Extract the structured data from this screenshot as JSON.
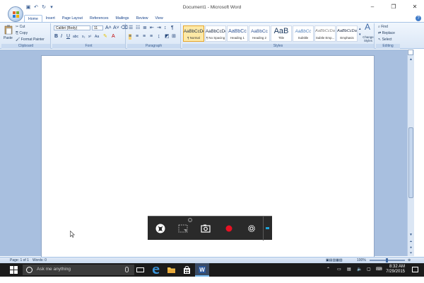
{
  "window": {
    "title": "Document1 - Microsoft Word",
    "controls": {
      "minimize": "‒",
      "maximize": "❐",
      "close": "✕"
    }
  },
  "tabs": [
    "Home",
    "Insert",
    "Page Layout",
    "References",
    "Mailings",
    "Review",
    "View"
  ],
  "active_tab": "Home",
  "ribbon": {
    "clipboard": {
      "label": "Clipboard",
      "paste": "Paste",
      "cut": "Cut",
      "copy": "Copy",
      "format_painter": "Format Painter"
    },
    "font": {
      "label": "Font",
      "font_name": "Calibri (Body)",
      "font_size": "11"
    },
    "paragraph": {
      "label": "Paragraph"
    },
    "styles": {
      "label": "Styles",
      "items": [
        {
          "sample": "AaBbCcDc",
          "name": "¶ Normal"
        },
        {
          "sample": "AaBbCcDc",
          "name": "¶ No Spacing"
        },
        {
          "sample": "AaBbCc",
          "name": "Heading 1"
        },
        {
          "sample": "AaBbCc",
          "name": "Heading 2"
        },
        {
          "sample": "AaB",
          "name": "Title"
        },
        {
          "sample": "AaBbCc",
          "name": "Subtitle"
        },
        {
          "sample": "AaBbCcDa",
          "name": "Subtle Emp..."
        },
        {
          "sample": "AaBbCcDa",
          "name": "Emphasis"
        }
      ],
      "change_styles": "Change Styles"
    },
    "editing": {
      "label": "Editing",
      "find": "Find",
      "replace": "Replace",
      "select": "Select"
    }
  },
  "statusbar": {
    "page": "Page: 1 of 1",
    "words": "Words: 0",
    "zoom": "100%"
  },
  "taskbar": {
    "search_placeholder": "Ask me anything",
    "time": "8:32 AM",
    "date": "7/29/2015"
  },
  "colors": {
    "ribbon_bg": "#dbe7f6",
    "canvas_bg": "#a8bfdf",
    "gamebar_bg": "#2a2a2a",
    "record_red": "#e81123",
    "taskbar_bg": "#1b1b1b"
  }
}
